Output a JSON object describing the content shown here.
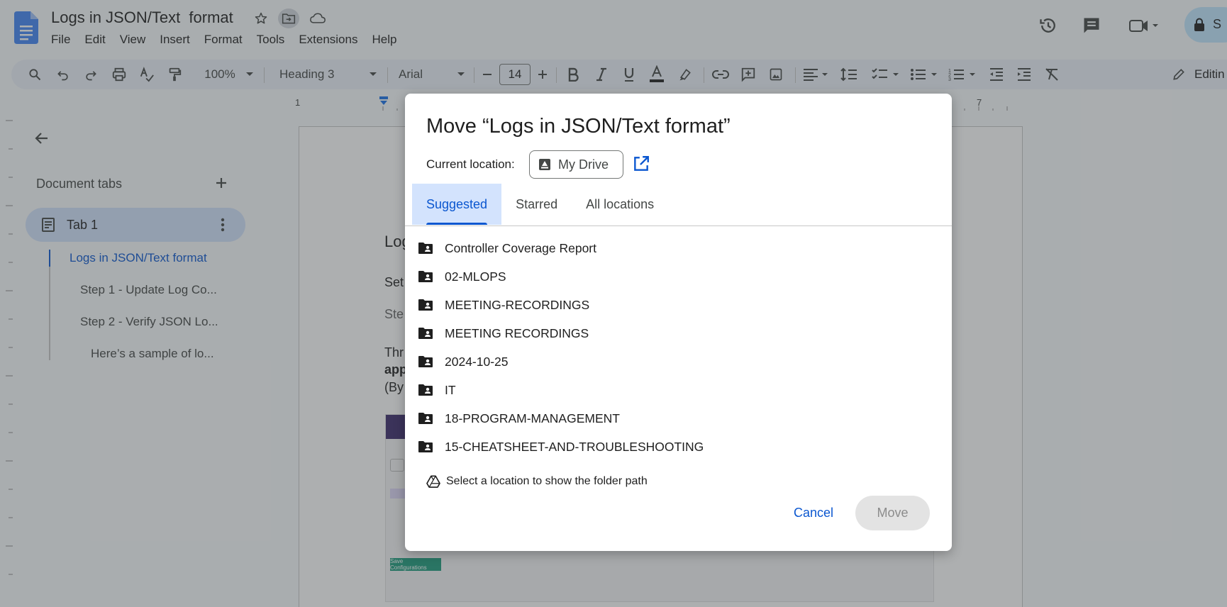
{
  "doc": {
    "title": "Logs in JSON/Text  format",
    "menu": [
      "File",
      "Edit",
      "View",
      "Insert",
      "Format",
      "Tools",
      "Extensions",
      "Help"
    ],
    "edit_mode_label": "Editin",
    "share_initial": "S"
  },
  "toolbar": {
    "zoom": "100%",
    "style": "Heading 3",
    "font": "Arial",
    "font_size": "14"
  },
  "ruler": {
    "marks": [
      "1",
      "7"
    ]
  },
  "sidebar": {
    "heading": "Document tabs",
    "tab_label": "Tab 1",
    "outline": [
      "Logs in JSON/Text format",
      "Step 1 - Update Log Co...",
      "Step 2 - Verify JSON Lo...",
      "Here’s a sample of lo..."
    ]
  },
  "page_fragments": [
    "Log",
    "Set",
    "Ste",
    "Thr",
    "app",
    "(By"
  ],
  "screenshot_button": "Save Configurations",
  "dialog": {
    "title": "Move “Logs in JSON/Text format”",
    "current_location_label": "Current location:",
    "current_location": "My Drive",
    "tabs": [
      "Suggested",
      "Starred",
      "All locations"
    ],
    "folders": [
      "Controller Coverage Report",
      "02-MLOPS",
      "MEETING-RECORDINGS",
      "MEETING RECORDINGS",
      "2024-10-25",
      "IT",
      "18-PROGRAM-MANAGEMENT",
      "15-CHEATSHEET-AND-TROUBLESHOOTING"
    ],
    "path_hint": "Select a location to show the folder path",
    "cancel_label": "Cancel",
    "move_label": "Move"
  },
  "colors": {
    "accent": "#0b57d0",
    "tab_highlight": "#d3e3fd",
    "toolbar_bg": "#edf2fa",
    "disabled_button": "#e3e3e3"
  }
}
